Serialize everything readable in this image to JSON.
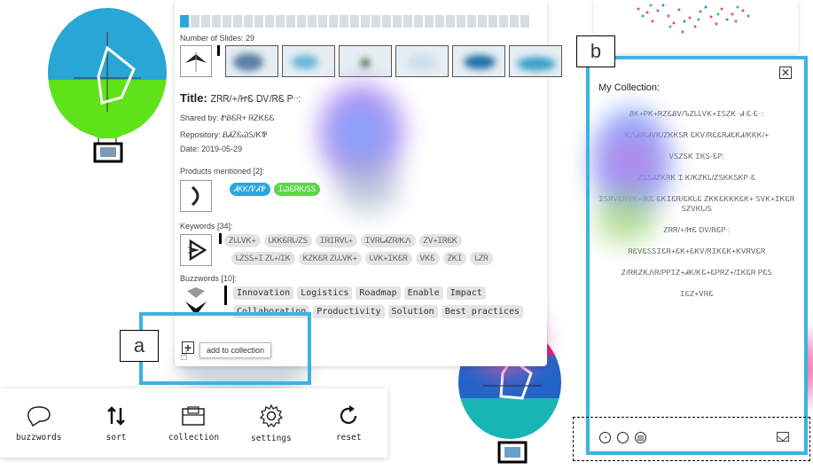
{
  "card": {
    "slide_count_label": "Number of Slides: 29",
    "title_prefix": "Title:",
    "title_text": "ᏃᏒᏒ/+/ᏥᏋ ᎠᏙ/ᏒᏋ Ꮲᐧᐧ:",
    "shared_by": "Shared by:  ᏑᏰᏋᏒ+ ᏒᏃᏦᏋᏋ",
    "repository": "Repository:  ᏰᏗᏃᏋᏊᏚ/ᏦᏈ",
    "date": "Date: 2019-05-29",
    "products_label": "Products mentioned [2]:",
    "products": [
      "ᏗᏦᏦ/ᏤᏗᏈ",
      "ᏆᏊᏋᏒᏦ/ᏚᏚ"
    ],
    "keywords_label": "Keywords [34]:",
    "keywords_row1": [
      "ᏃᏓᏓᏙᏦ+",
      "ᏓᏦᏦᏋᏒᏓ/ᏃᏚ",
      "ᏆᏒᏆᏒᏙᏓ+",
      "ᏆᏙᏒᏓᏗᏃᏒ/ᏦᏁ",
      "ᏃᏙ+ᏆᏒᏋᏦ"
    ],
    "keywords_row2": [
      "ᏓᏃᏚᏚ+Ꮖ ᏃᏓ+/ᏆᏦ",
      "ᏦᏃᏦᏋᏒ ᏃᏓᏓᏙᏦ+",
      "ᏓᏙᏦ+ᏆᏦᏋᏒ",
      "ᏙᏦᏋ",
      "ᏃᏦᏆ",
      "ᏓᏃᏒ"
    ],
    "buzzwords_label": "Buzzwords [10]:",
    "buzzwords_row1": [
      "Innovation",
      "Logistics",
      "Roadmap",
      "Enable",
      "Impact"
    ],
    "buzzwords_row2": [
      "Collaboration",
      "Productivity",
      "Solution",
      "Best practices"
    ]
  },
  "add_button": {
    "icon": "plus-icon",
    "tooltip": "add to collection"
  },
  "labels": {
    "a": "a",
    "b": "b"
  },
  "toolbar": {
    "items": [
      {
        "icon": "speech-bubble-icon",
        "label": "buzzwords"
      },
      {
        "icon": "sort-arrows-icon",
        "label": "sort"
      },
      {
        "icon": "folder-icon",
        "label": "collection"
      },
      {
        "icon": "gear-icon",
        "label": "settings"
      },
      {
        "icon": "refresh-icon",
        "label": "reset"
      }
    ]
  },
  "collection": {
    "title": "My Collection:",
    "close": "✕",
    "items": [
      "ᏰᏦ+ᏢᏦ+ᏒᏃᏋᏰᏙ/ᏖᏃᏓᏓᏙᏦ+ᏆᏚᏃᏦ ᐧᏗᐧᏋᐧᏋᐧᐧ:",
      "ᏦᏁᏗ/ᏦᏗᏙᏦ/ᏃᏦᏦᏚᏒ ᏋᏦᏙ/ᏒᏋᏋᏒᏗᏋᏦᏗ/ᏦᏦᏦ/+",
      "ᏙᏚᏃᏚᏦ ᏆᏦᏚ·ᏋᏢ:",
      "ᏃᏚᏚᏗᏃᏦᏒᏦ Ꮖ Ꮶ/ᏦᏃᏦᏓ/ᏃᏚᏦᏦᏚᏦᏢ·Ꮛ",
      "ᏆᏚᏒᏙᏋᏒᏙᏦ+/ᏦᏋ ᏋᏦᏆᏋᏒ/ᏋᏦᏓᏋ ᏃᏦᏦᏋᏦᏦᏦᏋᏦ+ ᏚᏙᏦ+ᏆᏦᏋᏒ ᏚᏃᏙᏦᏓ/Ꮪ",
      "ᏃᏒᏒ/+/ᏥᏋ ᎠᏙ/ᏒᏋᏢᐧ:",
      "ᏒᏋᏙᏋᏚᏚᏆᏋᏒ+ᏋᏦ+ᏋᏦᏙ/ᏒᏆᏦᏋᏦ+ᏦᏙᏒᏙᏋᏒ",
      "Ꮓ/ᏒᏦᏃᏦᏁᏒ/ᏢᏢᏆᏃ+ᏗᏦ/ᏦᏋ+ᏋᏢᏒᏃ+/ᏆᏦᏋᏒ ᏢᏋᏚ",
      "ᏆᏋᏃ+ᏙᏒᏋ"
    ]
  },
  "colors": {
    "accent": "#3cb3e1",
    "balloon_top": "#2aa6d6",
    "balloon_bottom": "#5ee21a"
  }
}
